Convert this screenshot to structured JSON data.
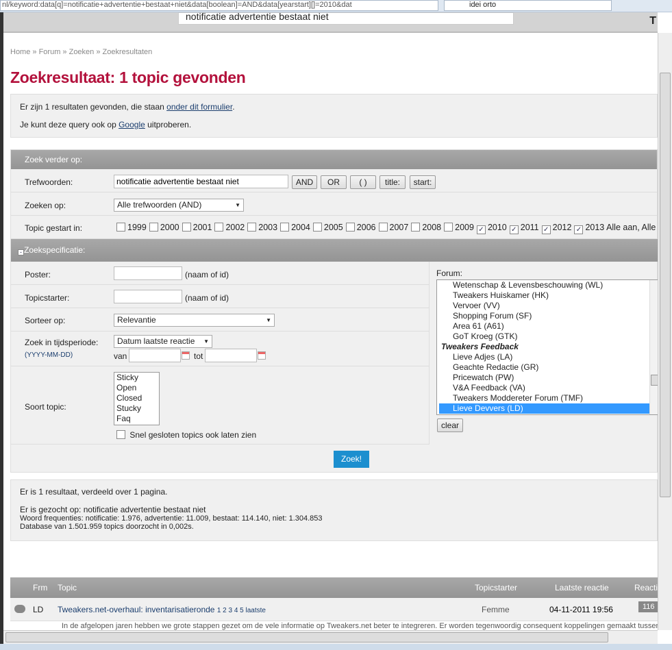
{
  "browser": {
    "url": "nl/keyword:data[q]=notificatie+advertentie+bestaat+niet&data[boolean]=AND&data[yearstart][]=2010&dat",
    "search": "idei orto"
  },
  "header": {
    "search_value": "notificatie advertentie bestaat niet",
    "right_text": "T"
  },
  "breadcrumb": [
    "Home",
    "Forum",
    "Zoeken",
    "Zoekresultaten"
  ],
  "title": "Zoekresultaat: 1 topic gevonden",
  "info": {
    "line1_pre": "Er zijn 1 resultaten gevonden, die staan ",
    "line1_link": "onder dit formulier",
    "line1_post": ".",
    "line2_pre": "Je kunt deze query ook op ",
    "line2_link": "Google",
    "line2_post": " uitproberen."
  },
  "form": {
    "bar_title": "Zoek verder op:",
    "keywords_label": "Trefwoorden:",
    "keywords_value": "notificatie advertentie bestaat niet",
    "buttons": [
      "AND",
      "OR",
      "( )",
      "title:",
      "start:"
    ],
    "searchon_label": "Zoeken op:",
    "searchon_value": "Alle trefwoorden (AND)",
    "started_label": "Topic gestart in:",
    "years": [
      {
        "y": "1999",
        "c": false
      },
      {
        "y": "2000",
        "c": false
      },
      {
        "y": "2001",
        "c": false
      },
      {
        "y": "2002",
        "c": false
      },
      {
        "y": "2003",
        "c": false
      },
      {
        "y": "2004",
        "c": false
      },
      {
        "y": "2005",
        "c": false
      },
      {
        "y": "2006",
        "c": false
      },
      {
        "y": "2007",
        "c": false
      },
      {
        "y": "2008",
        "c": false
      },
      {
        "y": "2009",
        "c": false
      },
      {
        "y": "2010",
        "c": true
      },
      {
        "y": "2011",
        "c": true
      },
      {
        "y": "2012",
        "c": true
      },
      {
        "y": "2013",
        "c": true
      }
    ],
    "years_extra": "Alle aan, Alle",
    "spec_title": "Zoekspecificatie:",
    "poster_label": "Poster:",
    "poster_hint": "(naam of id)",
    "starter_label": "Topicstarter:",
    "starter_hint": "(naam of id)",
    "sort_label": "Sorteer op:",
    "sort_value": "Relevantie",
    "period_label": "Zoek in tijdsperiode:",
    "period_format": "(YYYY-MM-DD)",
    "period_value": "Datum laatste reactie",
    "from": "van",
    "to": "tot",
    "type_label": "Soort topic:",
    "types": [
      "Sticky",
      "Open",
      "Closed",
      "Stucky",
      "Faq"
    ],
    "closed_label": "Snel gesloten topics ook laten zien",
    "forum_label": "Forum:",
    "forums": [
      {
        "n": "Wetenschap & Levensbeschouwing (WL)"
      },
      {
        "n": "Tweakers Huiskamer (HK)"
      },
      {
        "n": "Vervoer (VV)"
      },
      {
        "n": "Shopping Forum (SF)"
      },
      {
        "n": "Area 61 (A61)"
      },
      {
        "n": "GoT Kroeg (GTK)"
      },
      {
        "n": "Tweakers Feedback",
        "group": true
      },
      {
        "n": "Lieve Adjes (LA)"
      },
      {
        "n": "Geachte Redactie (GR)"
      },
      {
        "n": "Pricewatch (PW)"
      },
      {
        "n": "V&A Feedback (VA)"
      },
      {
        "n": "Tweakers Moddereter Forum (TMF)"
      },
      {
        "n": "Lieve Devvers (LD)",
        "selected": true
      }
    ],
    "clear": "clear",
    "submit": "Zoek!"
  },
  "results": {
    "line1": "Er is 1 resultaat, verdeeld over 1 pagina.",
    "line2": "Er is gezocht op: notificatie advertentie bestaat niet",
    "line3": "Woord frequenties: notificatie: 1.976, advertentie: 11.009, bestaat: 114.140, niet: 1.304.853",
    "line4": "Database van 1.501.959 topics doorzocht in 0,002s."
  },
  "table": {
    "headers": [
      "Frm",
      "Topic",
      "Topicstarter",
      "Laatste reactie",
      "Reacti"
    ],
    "rows": [
      {
        "frm": "LD",
        "topic": "Tweakers.net-overhaul: inventarisatieronde",
        "pages": "1 2 3 4 5 laatste",
        "starter": "Femme",
        "last": "04-11-2011 19:56",
        "replies": "116",
        "snippet": "In de afgelopen jaren hebben we grote stappen gezet om de vele informatie op Tweakers.net beter te integreren. Er worden tegenwoordig consequent koppelingen gemaakt tussen"
      }
    ]
  },
  "colors": {
    "accent": "#b3113c",
    "submit": "#1c8fcf",
    "selected": "#3399ff"
  }
}
